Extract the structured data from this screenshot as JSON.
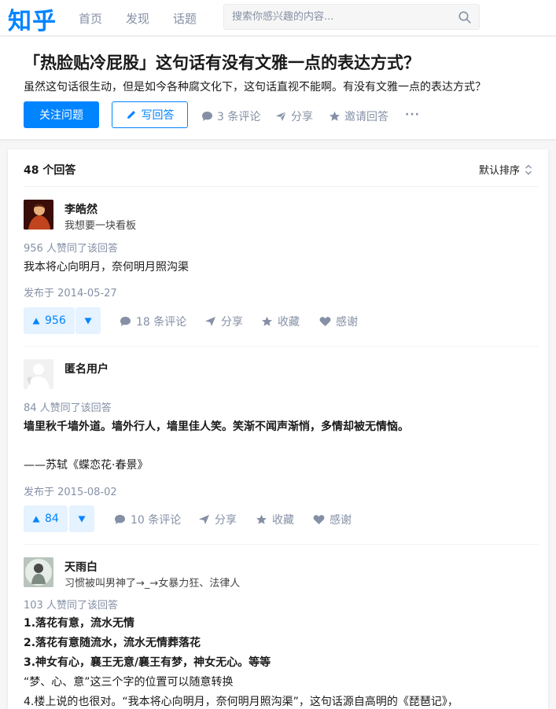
{
  "nav": {
    "logo": "知乎",
    "items": [
      "首页",
      "发现",
      "话题"
    ],
    "search_placeholder": "搜索你感兴趣的内容..."
  },
  "question": {
    "title": "「热脸贴冷屁股」这句话有没有文雅一点的表达方式？",
    "detail": "虽然这句话很生动，但是如今各种腐文化下，这句话直视不能啊。有没有文雅一点的表达方式？",
    "follow_label": "关注问题",
    "write_label": "写回答",
    "comments_label": "3 条评论",
    "share_label": "分享",
    "invite_label": "邀请回答",
    "more_label": "···"
  },
  "answers_header": {
    "count_label": "48 个回答",
    "sort_label": "默认排序"
  },
  "answers": [
    {
      "author": "李皓然",
      "bio": "我想要一块看板",
      "votes_text": "956 人赞同了该回答",
      "content": [
        "我本将心向明月，奈何明月照沟渠"
      ],
      "date": "发布于 2014-05-27",
      "vote_count": "956",
      "comments": "18 条评论",
      "share": "分享",
      "collect": "收藏",
      "thanks": "感谢"
    },
    {
      "author": "匿名用户",
      "bio": "",
      "votes_text": "84 人赞同了该回答",
      "content": [
        "墙里秋千墙外道。墙外行人，墙里佳人笑。笑渐不闻声渐悄，多情却被无情恼。",
        "——苏轼《蝶恋花·春景》"
      ],
      "date": "发布于 2015-08-02",
      "vote_count": "84",
      "comments": "10 条评论",
      "share": "分享",
      "collect": "收藏",
      "thanks": "感谢"
    },
    {
      "author": "天雨白",
      "bio": "习惯被叫男神了→_→女暴力狂、法律人",
      "votes_text": "103 人赞同了该回答",
      "content": [
        "1.落花有意，流水无情",
        "2.落花有意随流水，流水无情葬落花",
        "3.神女有心，襄王无意/襄王有梦，神女无心。等等",
        "“梦、心、意”这三个字的位置可以随意转换",
        "4.楼上说的也很对。“我本将心向明月，奈何明月照沟渠”，这句话源自高明的《琵琶记》，"
      ]
    }
  ],
  "colors": {
    "brand": "#0084ff",
    "muted": "#8590a6",
    "vote_bg": "#e5f2ff"
  }
}
